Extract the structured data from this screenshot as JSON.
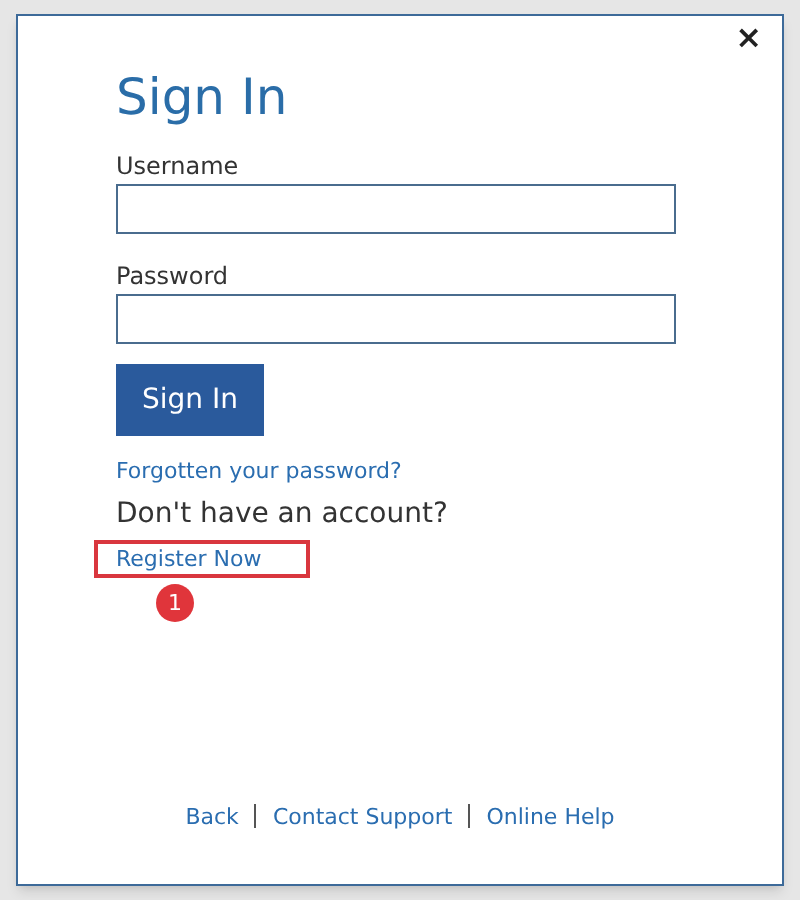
{
  "dialog": {
    "close": "×",
    "title": "Sign In"
  },
  "fields": [
    {
      "label": "Username"
    },
    {
      "label": "Password"
    }
  ],
  "submit": "Sign In",
  "forgot_link": "Forgotten your password?",
  "register_prompt": "Don't have an account?",
  "register_link": "Register Now",
  "callout": {
    "number": "1"
  },
  "footer_links": [
    "Back",
    "Contact Support",
    "Online Help"
  ]
}
